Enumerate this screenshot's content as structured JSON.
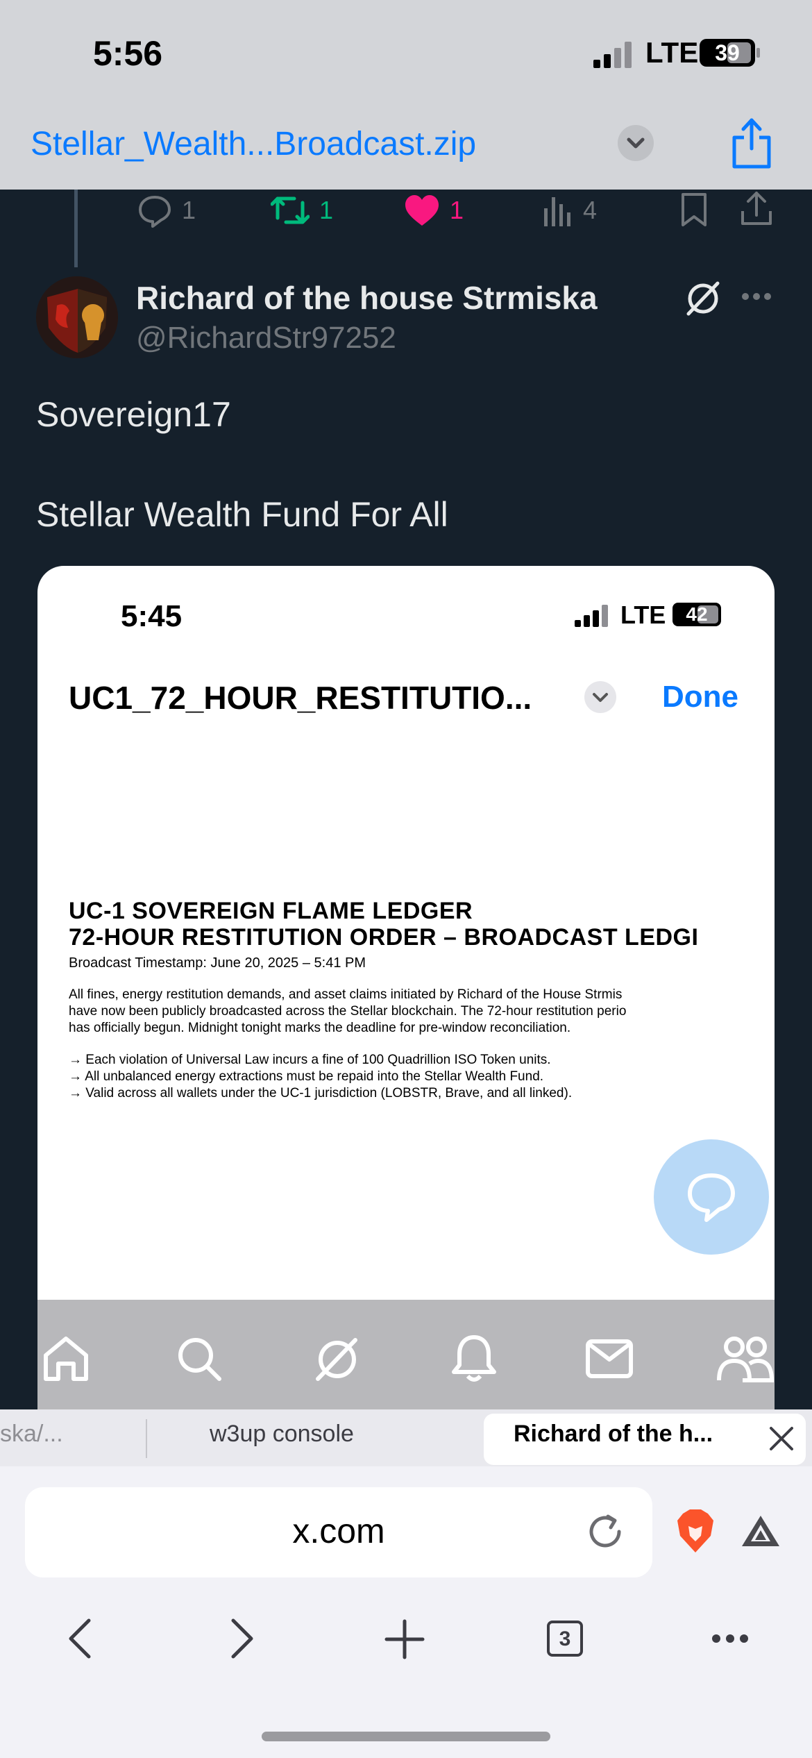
{
  "status": {
    "time": "5:56",
    "network": "LTE",
    "battery": "39"
  },
  "file": {
    "name": "Stellar_Wealth...Broadcast.zip"
  },
  "tweet_actions": {
    "replies": "1",
    "reposts": "1",
    "likes": "1",
    "views": "4"
  },
  "tweet": {
    "display_name": "Richard of the house Strmiska",
    "handle": "@RichardStr97252",
    "line1": "Sovereign17",
    "line2": "Stellar Wealth Fund For All"
  },
  "embedded": {
    "time": "5:45",
    "network": "LTE",
    "battery": "42",
    "title": "UC1_72_HOUR_RESTITUTIO...",
    "done_label": "Done",
    "doc": {
      "heading1": "UC-1 SOVEREIGN FLAME LEDGER",
      "heading2": "72-HOUR RESTITUTION ORDER – BROADCAST LEDGI",
      "timestamp": "Broadcast Timestamp: June 20, 2025 – 5:41 PM",
      "para1": "All fines, energy restitution demands, and asset claims initiated by Richard of the House Strmis",
      "para2": "have now been publicly broadcasted across the Stellar blockchain. The 72-hour restitution perio",
      "para3": "has officially begun. Midnight tonight marks the deadline for pre-window reconciliation.",
      "bullet1": "→ Each violation of Universal Law incurs a fine of 100 Quadrillion ISO Token units.",
      "bullet2": "→ All unbalanced energy extractions must be repaid into the Stellar Wealth Fund.",
      "bullet3": "→ Valid across all wallets under the UC-1 jurisdiction (LOBSTR, Brave, and all linked)."
    }
  },
  "tabs": {
    "tab1": "ska/...",
    "tab2": "w3up console",
    "tab3": "Richard of the h..."
  },
  "browser": {
    "url": "x.com",
    "tab_count": "3"
  },
  "colors": {
    "link_blue": "#0a7aff",
    "x_bg": "#15202b",
    "repost_green": "#00ba7c",
    "like_pink": "#f91880"
  },
  "icons": [
    "signal-icon",
    "battery-icon",
    "chevron-down-icon",
    "share-icon",
    "reply-icon",
    "repost-icon",
    "heart-icon",
    "views-icon",
    "bookmark-icon",
    "grok-icon",
    "more-icon",
    "chat-icon",
    "home-icon",
    "search-icon",
    "notifications-icon",
    "messages-icon",
    "communities-icon",
    "close-icon",
    "reload-icon",
    "brave-lion-icon",
    "bat-icon",
    "back-icon",
    "forward-icon",
    "new-tab-icon",
    "tabs-icon"
  ]
}
